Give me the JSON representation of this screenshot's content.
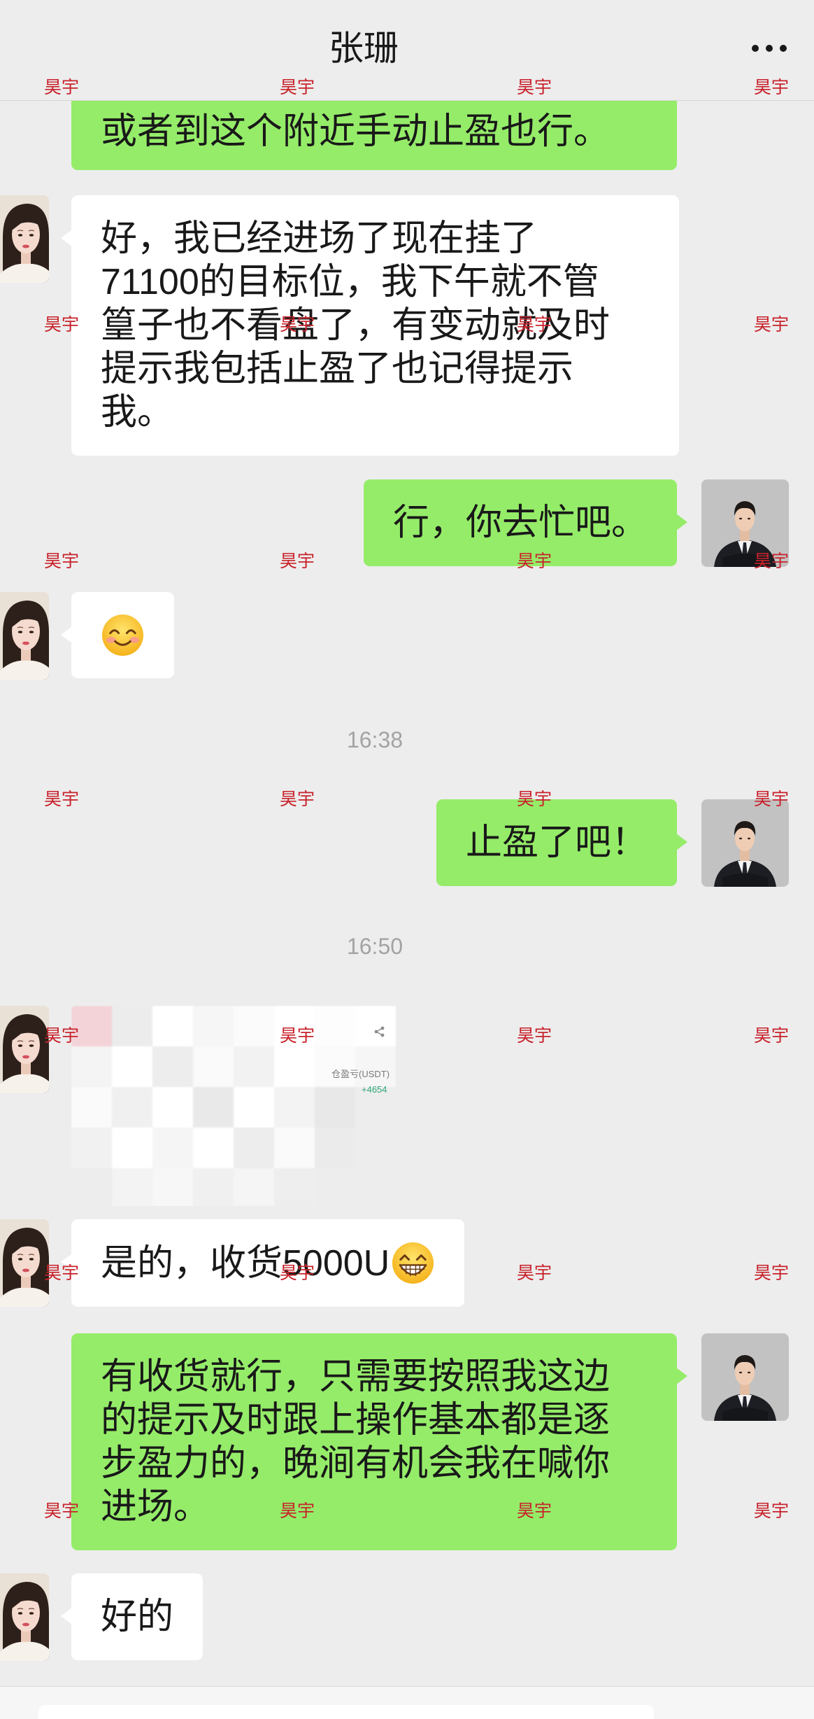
{
  "header": {
    "title": "张珊",
    "more_icon": "more-horizontal-icon"
  },
  "watermark": {
    "text": "昊宇"
  },
  "colors": {
    "background": "#ededed",
    "outgoing_bubble": "#95ec69",
    "incoming_bubble": "#ffffff",
    "watermark": "#c8232c",
    "timestamp": "#a3a3a3",
    "pnl_positive": "#2fa87a"
  },
  "avatars": {
    "contact": "woman-portrait-avatar",
    "self": "man-in-suit-avatar"
  },
  "messages": [
    {
      "direction": "outgoing",
      "type": "text",
      "lines": [
        "或者到这个附近手动止盈也行。"
      ]
    },
    {
      "direction": "incoming",
      "type": "text",
      "lines": [
        "好，我已经进场了现在挂了",
        "71100的目标位，我下午就不管",
        "篁子也不看盘了，有变动就及时",
        "提示我包括止盈了也记得提示",
        "我。"
      ]
    },
    {
      "direction": "outgoing",
      "type": "text",
      "lines": [
        "行，你去忙吧。"
      ]
    },
    {
      "direction": "incoming",
      "type": "emoji",
      "emoji": "smiling-face-with-smiling-eyes"
    },
    {
      "type": "timestamp",
      "text": "16:38"
    },
    {
      "direction": "outgoing",
      "type": "text",
      "lines": [
        "止盈了吧！"
      ]
    },
    {
      "type": "timestamp",
      "text": "16:50"
    },
    {
      "direction": "incoming",
      "type": "image",
      "image": {
        "pnl_label": "仓盈亏(USDT)",
        "pnl_value": "+4654",
        "share_icon": "share-icon"
      }
    },
    {
      "direction": "incoming",
      "type": "text",
      "lines": [
        "是的，收货5000U"
      ],
      "emoji": "beaming-face-with-smiling-eyes"
    },
    {
      "direction": "outgoing",
      "type": "text",
      "lines": [
        "有收货就行，只需要按照我这边",
        "的提示及时跟上操作基本都是逐",
        "步盈力的，晚涧有机会我在喊你",
        "进场。"
      ]
    },
    {
      "direction": "incoming",
      "type": "text",
      "lines": [
        "好的"
      ]
    }
  ]
}
